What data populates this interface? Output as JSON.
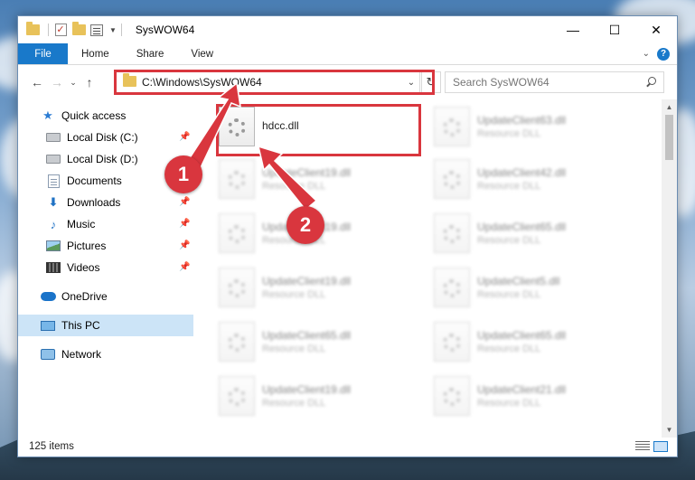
{
  "window": {
    "title": "SysWOW64",
    "controls": {
      "minimize": "—",
      "maximize": "☐",
      "close": "✕"
    }
  },
  "ribbon": {
    "file": "File",
    "tabs": [
      "Home",
      "Share",
      "View"
    ],
    "collapse_glyph": "⌄",
    "help_glyph": "?"
  },
  "navbar": {
    "back": "←",
    "forward": "→",
    "recent": "⌄",
    "up": "↑",
    "address": "C:\\Windows\\SysWOW64",
    "address_dropdown": "⌄",
    "refresh": "↻",
    "search_placeholder": "Search SysWOW64"
  },
  "sidebar": {
    "items": [
      {
        "label": "Quick access",
        "icon": "star-icon",
        "pinned": false
      },
      {
        "label": "Local Disk (C:)",
        "icon": "disk-icon",
        "pinned": true
      },
      {
        "label": "Local Disk (D:)",
        "icon": "disk-icon",
        "pinned": false
      },
      {
        "label": "Documents",
        "icon": "documents-icon",
        "pinned": true
      },
      {
        "label": "Downloads",
        "icon": "downloads-icon",
        "pinned": true
      },
      {
        "label": "Music",
        "icon": "music-icon",
        "pinned": true
      },
      {
        "label": "Pictures",
        "icon": "pictures-icon",
        "pinned": true
      },
      {
        "label": "Videos",
        "icon": "videos-icon",
        "pinned": true
      },
      {
        "label": "OneDrive",
        "icon": "onedrive-icon",
        "pinned": false
      },
      {
        "label": "This PC",
        "icon": "this-pc-icon",
        "pinned": false,
        "selected": true
      },
      {
        "label": "Network",
        "icon": "network-icon",
        "pinned": false
      }
    ],
    "pin_glyph": "📌"
  },
  "files": {
    "left": [
      {
        "name": "hdcc.dll",
        "type": "",
        "highlighted": true
      },
      {
        "name": "UpdateClient19.dll",
        "type": "Resource DLL"
      },
      {
        "name": "UpdateClient19.dll",
        "type": "Resource DLL"
      },
      {
        "name": "UpdateClient19.dll",
        "type": "Resource DLL"
      },
      {
        "name": "UpdateClient65.dll",
        "type": "Resource DLL"
      },
      {
        "name": "UpdateClient19.dll",
        "type": "Resource DLL"
      }
    ],
    "right": [
      {
        "name": "UpdateClient63.dll",
        "type": "Resource DLL"
      },
      {
        "name": "UpdateClient42.dll",
        "type": "Resource DLL"
      },
      {
        "name": "UpdateClient65.dll",
        "type": "Resource DLL"
      },
      {
        "name": "UpdateClient5.dll",
        "type": "Resource DLL"
      },
      {
        "name": "UpdateClient65.dll",
        "type": "Resource DLL"
      },
      {
        "name": "UpdateClient21.dll",
        "type": "Resource DLL"
      }
    ]
  },
  "scrollbar": {
    "up": "▲",
    "down": "▼"
  },
  "status": {
    "count": "125 items"
  },
  "callouts": [
    "1",
    "2"
  ],
  "colors": {
    "accent": "#1979ca",
    "highlight": "#d9363e",
    "selected": "#cce4f7"
  }
}
